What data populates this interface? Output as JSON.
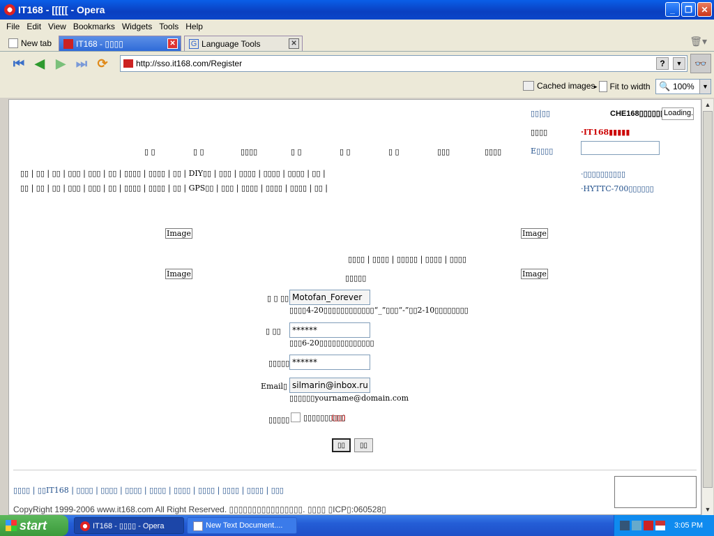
{
  "window": {
    "title": "IT168 - [[[[[ - Opera"
  },
  "menu": [
    "File",
    "Edit",
    "View",
    "Bookmarks",
    "Widgets",
    "Tools",
    "Help"
  ],
  "tabs": [
    {
      "label": "New tab"
    },
    {
      "label": "IT168 - ▯▯▯▯"
    },
    {
      "label": "Language Tools"
    }
  ],
  "address": {
    "url": "http://sso.it168.com/Register",
    "help": "?"
  },
  "viewbar": {
    "cached_images": "Cached images",
    "fit_to_width": "Fit to width",
    "zoom": "100%"
  },
  "page": {
    "top_right": {
      "login_label": "▯▯|▯▯",
      "che168": "CHE168▯▯▯▯▯▯▯▯",
      "loading": "Loading...",
      "label2": "▯▯▯▯",
      "it168_red": "·IT168▮▮▮▮▮",
      "label3": "E▯▯▯▯",
      "link1": "·▯▯▯▯▯▯▯▯▯▯",
      "link2": "·HYTTC-700▯▯▯▯▯▯"
    },
    "nav_top": [
      "▯ ▯",
      "▯ ▯",
      "▯▯▯▯",
      "▯ ▯",
      "▯ ▯",
      "▯ ▯",
      "▯▯▯",
      "▯▯▯▯"
    ],
    "nav_row1": "▯▯ | ▯▯ | ▯▯ | ▯▯▯ | ▯▯▯ | ▯▯ | ▯▯▯▯ | ▯▯▯▯ | ▯▯ | DIY▯▯ | ▯▯▯ | ▯▯▯▯ | ▯▯▯▯ | ▯▯▯▯ | ▯▯ |",
    "nav_row2": "▯▯ | ▯▯ | ▯▯ | ▯▯▯ | ▯▯▯ | ▯▯ | ▯▯▯▯ | ▯▯▯▯ | ▯▯ | GPS▯▯ | ▯▯▯ | ▯▯▯▯ | ▯▯▯▯ | ▯▯▯▯ | ▯▯ |",
    "image_alt": "Image",
    "steps": "▯▯▯▯ | ▯▯▯▯ | ▯▯▯▯▯ | ▯▯▯▯ | ▯▯▯▯",
    "form_title": "▯▯▯▯▯",
    "form": {
      "username_label": "▯ ▯ ▯▯",
      "username_value": "Motofan_Forever",
      "username_hint": "▯▯▯▯4-20▯▯▯▯▯▯▯▯▯▯▯▯“_”▯▯▯“-”▯▯2-10▯▯▯▯▯▯▯▯",
      "password_label": "▯   ▯▯",
      "password_value": "******",
      "password_hint": "▯▯▯6-20▯▯▯▯▯▯▯▯▯▯▯▯▯",
      "confirm_label": "▯▯▯▯▯",
      "confirm_value": "******",
      "email_label": "Email▯",
      "email_value": "silmarin@inbox.ru",
      "email_hint": "▯▯▯▯▯▯yourname@domain.com",
      "agree_label": "▯▯▯▯▯",
      "agree_text": "▯▯▯▯▯▯▯▯▯▯",
      "agree_red": "(▯▯)",
      "submit": "▯▯",
      "reset": "▯▯"
    },
    "footer_links": "▯▯▯▯ | ▯▯IT168 | ▯▯▯▯ | ▯▯▯▯ | ▯▯▯▯ | ▯▯▯▯ | ▯▯▯▯ | ▯▯▯▯ | ▯▯▯▯ | ▯▯▯▯ | ▯▯▯",
    "copyright": "CopyRight 1999-2006 www.it168.com All Right Reserved. ▯▯▯▯▯▯▯▯▯▯▯▯▯▯▯▯. ▯▯▯▯ ▯ICP▯:060528▯"
  },
  "taskbar": {
    "start": "start",
    "items": [
      "IT168 - ▯▯▯▯ - Opera",
      "New Text Document...."
    ],
    "clock": "3:05 PM"
  }
}
